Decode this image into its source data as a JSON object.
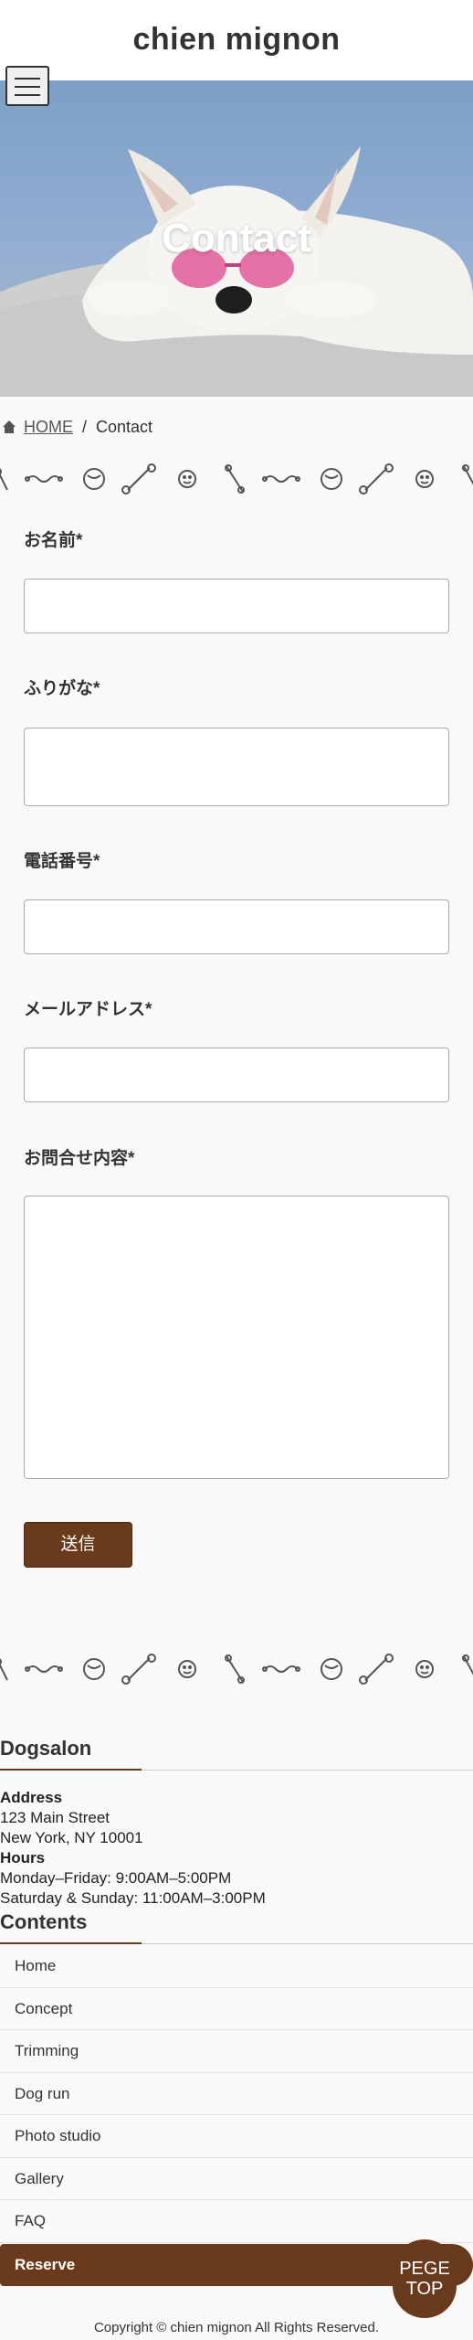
{
  "header": {
    "site_title": "chien mignon"
  },
  "hero": {
    "title": "Contact"
  },
  "breadcrumb": {
    "home": "HOME",
    "separator": "/",
    "current": "Contact"
  },
  "form": {
    "fields": [
      {
        "label": "お名前*",
        "value": ""
      },
      {
        "label": "ふりがな*",
        "value": ""
      },
      {
        "label": "電話番号*",
        "value": ""
      },
      {
        "label": "メールアドレス*",
        "value": ""
      },
      {
        "label": "お問合せ内容*",
        "value": ""
      }
    ],
    "submit_label": "送信"
  },
  "footer": {
    "salon_heading": "Dogsalon",
    "address_title": "Address",
    "address_line1": "123 Main Street",
    "address_line2": "New York, NY 10001",
    "hours_title": "Hours",
    "hours_line1": "Monday–Friday: 9:00AM–5:00PM",
    "hours_line2": "Saturday & Sunday: 11:00AM–3:00PM",
    "contents_heading": "Contents",
    "nav": [
      "Home",
      "Concept",
      "Trimming",
      "Dog run",
      "Photo studio",
      "Gallery",
      "FAQ"
    ],
    "reserve_label": "Reserve",
    "page_top_line1": "PEGE",
    "page_top_line2": "TOP",
    "copyright": "Copyright © chien mignon All Rights Reserved."
  },
  "colors": {
    "accent_brown": "#6a3a1c",
    "background": "#f9f9f9"
  },
  "icons": [
    "menu-icon",
    "home-icon",
    "bone-icon",
    "rope-toy-icon",
    "ball-icon",
    "smiley-icon",
    "chew-toy-icon"
  ]
}
